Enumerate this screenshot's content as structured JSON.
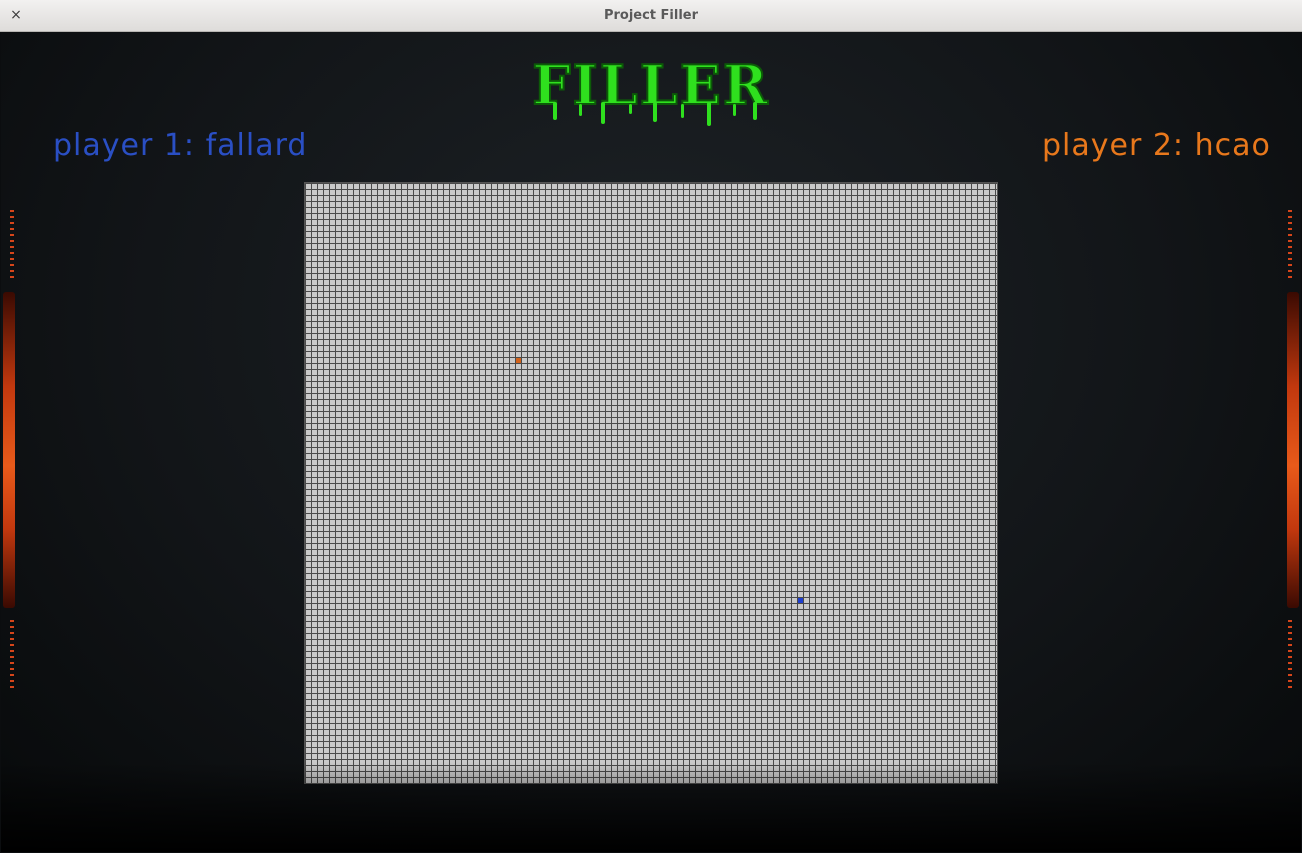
{
  "window": {
    "title": "Project Filler",
    "close_glyph": "×"
  },
  "logo": {
    "text": "FILLER",
    "color": "#2fe01e",
    "icon": "slime-logo-icon"
  },
  "players": [
    {
      "label": "player 1: fallard",
      "color": "#2a4fc4"
    },
    {
      "label": "player 2: hcao",
      "color": "#e8781c"
    }
  ],
  "board": {
    "cell_color": "#c9c9c9",
    "grid_line_color": "#4a4a4a",
    "pieces": [
      {
        "player": 1,
        "color": "#1f3fd0"
      },
      {
        "player": 2,
        "color": "#d2621a"
      }
    ]
  },
  "accent_colors": {
    "side_glow": "#e85a1a"
  }
}
